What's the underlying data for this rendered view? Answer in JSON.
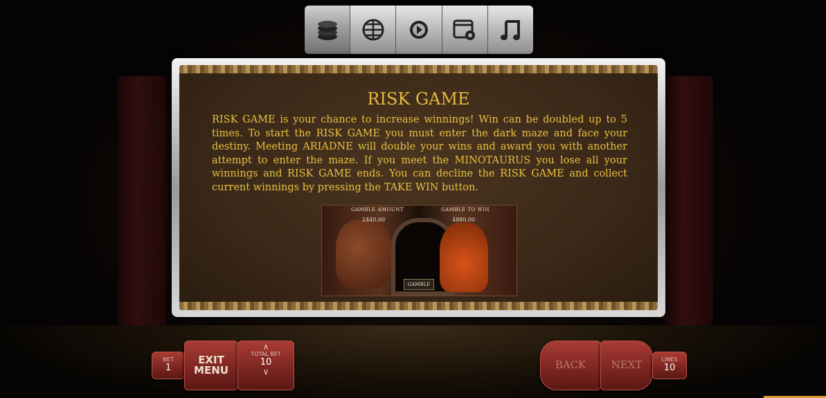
{
  "tabs": [
    {
      "name": "coins-icon",
      "active": true
    },
    {
      "name": "globe-dollar-icon",
      "active": false
    },
    {
      "name": "play-gear-icon",
      "active": false
    },
    {
      "name": "window-settings-icon",
      "active": false
    },
    {
      "name": "music-note-icon",
      "active": false
    }
  ],
  "panel": {
    "title": "RISK GAME",
    "body": "RISK GAME is your chance to increase winnings! Win can be doubled up to 5 times. To start the RISK GAME you must enter the dark maze and face your destiny. Meeting ARIADNE will double your wins and award you with another attempt to enter the maze. If you meet the MINOTAURUS you lose all your winnings and RISK GAME ends. You can decline the RISK GAME and collect current winnings by pressing the TAKE WIN button.",
    "preview": {
      "gamble_amount_label": "GAMBLE AMOUNT",
      "gamble_amount_value": "2440.00",
      "gamble_to_win_label": "GAMBLE TO WIN",
      "gamble_to_win_value": "4880.00",
      "gamble_button": "GAMBLE"
    }
  },
  "controls": {
    "bet_label": "BET",
    "bet_value": "1",
    "exit_menu_line1": "EXIT",
    "exit_menu_line2": "MENU",
    "total_bet_label": "TOTAL BET",
    "total_bet_value": "10",
    "back_label": "BACK",
    "next_label": "NEXT",
    "lines_label": "LINES",
    "lines_value": "10"
  },
  "colors": {
    "accent_gold": "#e8c040",
    "button_red": "#7a2420"
  }
}
